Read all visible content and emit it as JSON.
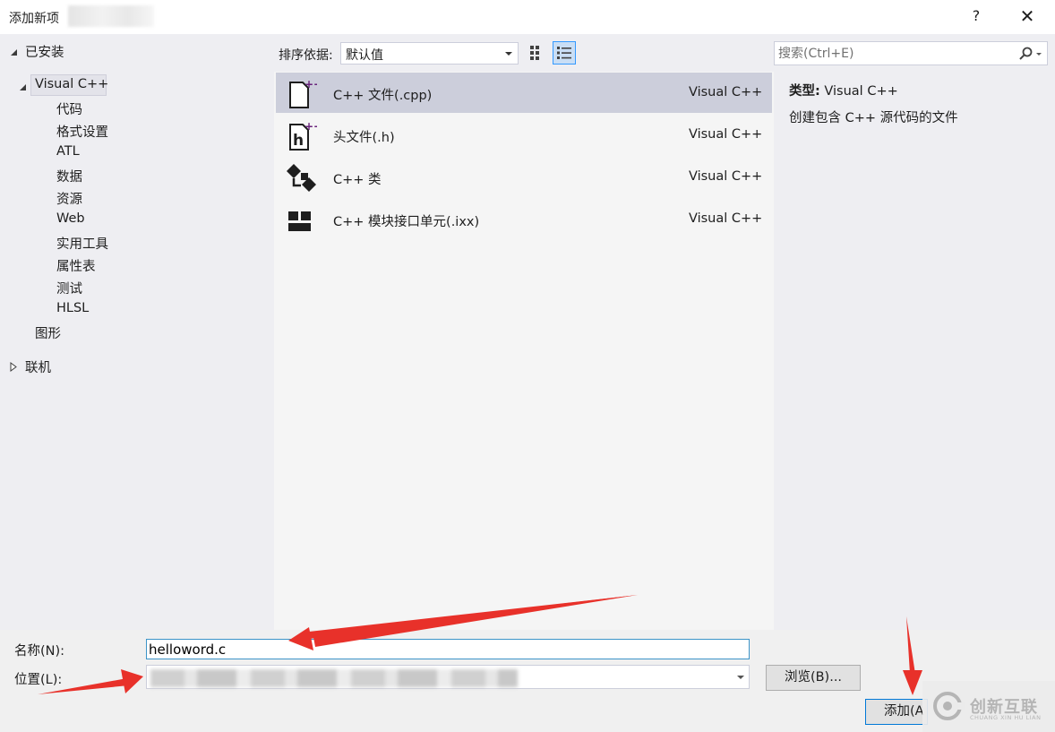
{
  "window": {
    "title": "添加新项",
    "help": "?",
    "close": "✕"
  },
  "tree": {
    "installed": "已安装",
    "visual_cpp": "Visual C++",
    "children": [
      "代码",
      "格式设置",
      "ATL",
      "数据",
      "资源",
      "Web",
      "实用工具",
      "属性表",
      "测试",
      "HLSL"
    ],
    "graphics": "图形",
    "online": "联机"
  },
  "toolbar": {
    "sort_label": "排序依据:",
    "sort_value": "默认值"
  },
  "search": {
    "placeholder": "搜索(Ctrl+E)"
  },
  "templates": [
    {
      "name": "C++ 文件(.cpp)",
      "lang": "Visual C++",
      "icon": "cpp-file-icon",
      "selected": true
    },
    {
      "name": "头文件(.h)",
      "lang": "Visual C++",
      "icon": "header-file-icon",
      "selected": false
    },
    {
      "name": "C++ 类",
      "lang": "Visual C++",
      "icon": "cpp-class-icon",
      "selected": false
    },
    {
      "name": "C++ 模块接口单元(.ixx)",
      "lang": "Visual C++",
      "icon": "module-icon",
      "selected": false
    }
  ],
  "details": {
    "type_label": "类型:",
    "type_value": "Visual C++",
    "description": "创建包含 C++ 源代码的文件"
  },
  "form": {
    "name_label": "名称(N):",
    "name_value": "helloword.c",
    "location_label": "位置(L):",
    "browse_label": "浏览(B)...",
    "add_label": "添加(A"
  },
  "watermark": {
    "text": "创新互联",
    "sub": "CHUANG XIN HU LIAN"
  },
  "colors": {
    "annotation_arrow": "#e8312a",
    "selection": "#cccedb",
    "accent": "#0078d7",
    "cpp_badge": "#68217a"
  }
}
